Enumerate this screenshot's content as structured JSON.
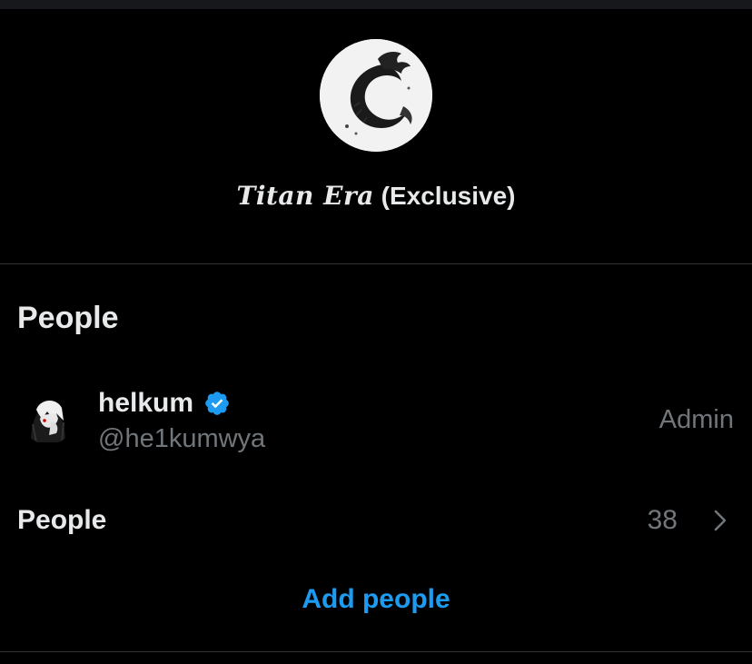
{
  "group": {
    "name_styled": "Titan Era",
    "name_suffix": "(Exclusive)",
    "avatar_icon": "dragon-logo-icon"
  },
  "people_section": {
    "title": "People",
    "members": [
      {
        "name": "helkum",
        "handle": "@he1kumwya",
        "role": "Admin",
        "verified": true,
        "avatar_icon": "anime-avatar-icon"
      }
    ],
    "people_row": {
      "label": "People",
      "count": "38"
    },
    "add_people_label": "Add people"
  },
  "colors": {
    "background": "#000000",
    "text_primary": "#e7e9ea",
    "text_secondary": "#71767b",
    "accent": "#1d9bf0",
    "divider": "#2f3336"
  }
}
